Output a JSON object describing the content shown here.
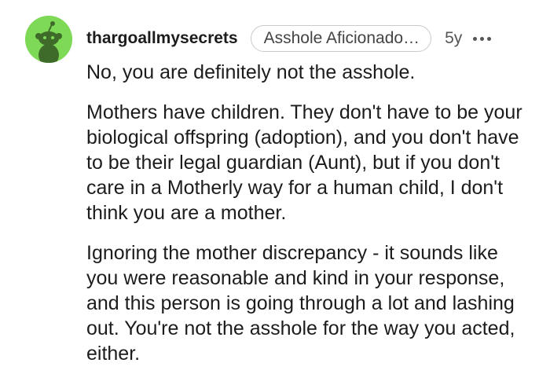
{
  "comment": {
    "username": "thargoallmysecrets",
    "flair": "Asshole Aficionado…",
    "age": "5y",
    "paragraphs": [
      "No, you are definitely not the asshole.",
      "Mothers have children. They don't have to be your biological offspring (adoption), and you don't have to be their legal guardian (Aunt), but if you don't care in a Motherly way for a human child, I don't think you are a mother.",
      "Ignoring the mother discrepancy - it sounds like you were reasonable and kind in your response, and this person is going through a lot and lashing out. You're not the asshole for the way you acted, either."
    ]
  },
  "icons": {
    "avatar": "snoo-avatar-icon",
    "more": "more-options-icon"
  },
  "colors": {
    "avatar_background": "#7ed957",
    "avatar_figure": "#3f6b2a",
    "text": "#1c1c1c",
    "meta_text": "#555555",
    "flair_border": "#c9c9c9"
  }
}
